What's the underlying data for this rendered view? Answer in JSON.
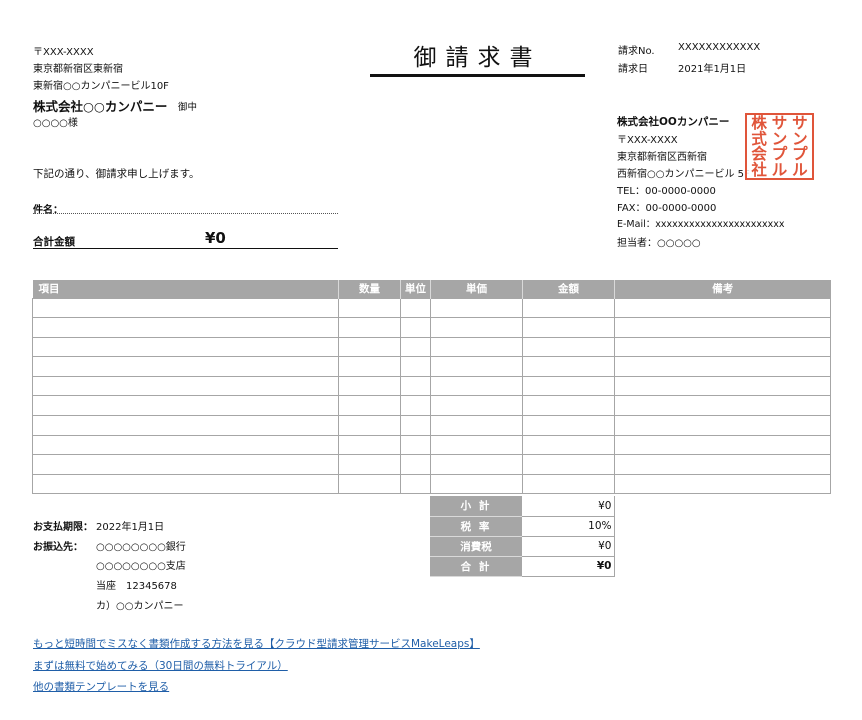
{
  "title": "御請求書",
  "client": {
    "postal": "〒XXX-XXXX",
    "address1": "東京都新宿区東新宿",
    "address2": "東新宿○○カンパニービル10F",
    "company": "株式会社○○カンパニー",
    "suffix": "御中",
    "person": "○○○○様"
  },
  "meta": {
    "invoice_no_label": "請求No.",
    "invoice_no": "XXXXXXXXXXXX",
    "date_label": "請求日",
    "date": "2021年1月1日"
  },
  "issuer": {
    "company": "株式会社OOカンパニー",
    "postal": "〒XXX-XXXX",
    "address1": "東京都新宿区西新宿",
    "address2": "西新宿○○カンパニービル 5F",
    "tel": "TEL：00-0000-0000",
    "fax": "FAX：00-0000-0000",
    "email": "E-Mail：xxxxxxxxxxxxxxxxxxxxxxx",
    "contact": "担当者：○○○○○"
  },
  "seal": {
    "color": "#e0553a",
    "columns": [
      "サンプル",
      "サンプル",
      "株式会社"
    ]
  },
  "intro": "下記の通り、御請求申し上げます。",
  "subject_label": "件名：",
  "total_label": "合計金額",
  "total_value": "¥0",
  "table": {
    "headers": [
      "項目",
      "数量",
      "単位",
      "単価",
      "金額",
      "備考"
    ],
    "row_count": 10
  },
  "summary": [
    {
      "label": "小 計",
      "value": "¥0"
    },
    {
      "label": "税 率",
      "value": "10%"
    },
    {
      "label": "消費税",
      "value": "¥0"
    },
    {
      "label": "合 計",
      "value": "¥0"
    }
  ],
  "payment": {
    "deadline_label": "お支払期限：",
    "deadline": "2022年1月1日",
    "bank_label": "お振込先：",
    "bank": "○○○○○○○○銀行",
    "branch": "○○○○○○○○支店",
    "account": "当座　12345678",
    "holder": "カ）○○カンパニー"
  },
  "links": [
    "もっと短時間でミスなく書類作成する方法を見る【クラウド型請求管理サービスMakeLeaps】",
    "まずは無料で始めてみる（30日間の無料トライアル）",
    "他の書類テンプレートを見る"
  ],
  "colors": {
    "header_gray": "#a6a6a6",
    "link": "#1f5ea8"
  }
}
